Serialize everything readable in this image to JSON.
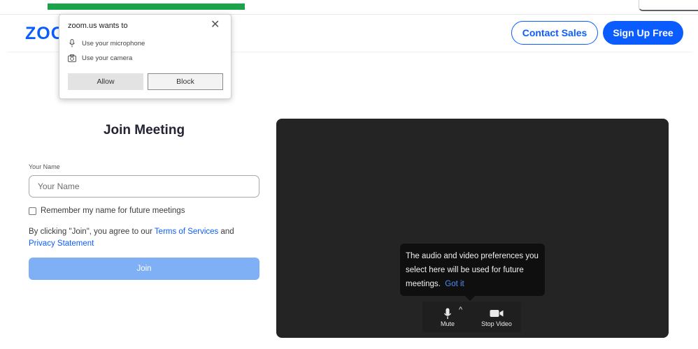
{
  "header": {
    "logo_text": "ZOO",
    "contact_sales": "Contact Sales",
    "sign_up_free": "Sign Up Free"
  },
  "permission_popup": {
    "title": "zoom.us wants to",
    "close_glyph": "✕",
    "permissions": [
      {
        "icon": "microphone-icon",
        "label": "Use your microphone"
      },
      {
        "icon": "camera-icon",
        "label": "Use your camera"
      }
    ],
    "allow": "Allow",
    "block": "Block"
  },
  "join_form": {
    "title": "Join Meeting",
    "name_label": "Your Name",
    "name_placeholder": "Your Name",
    "name_value": "",
    "remember_label": "Remember my name for future meetings",
    "remember_checked": false,
    "terms_prefix": "By clicking \"Join\", you agree to our ",
    "terms_link": "Terms of Services",
    "terms_and": " and",
    "privacy_link": "Privacy Statement",
    "join_button": "Join"
  },
  "preview": {
    "tooltip_text": "The audio and video preferences you select here will be used for future meetings.",
    "tooltip_link": "Got it",
    "mute_label": "Mute",
    "stop_video_label": "Stop Video"
  },
  "colors": {
    "brand_blue": "#0b5cff",
    "join_disabled": "#7fb0f6",
    "video_bg": "#242424",
    "top_green": "#1aa34a"
  }
}
